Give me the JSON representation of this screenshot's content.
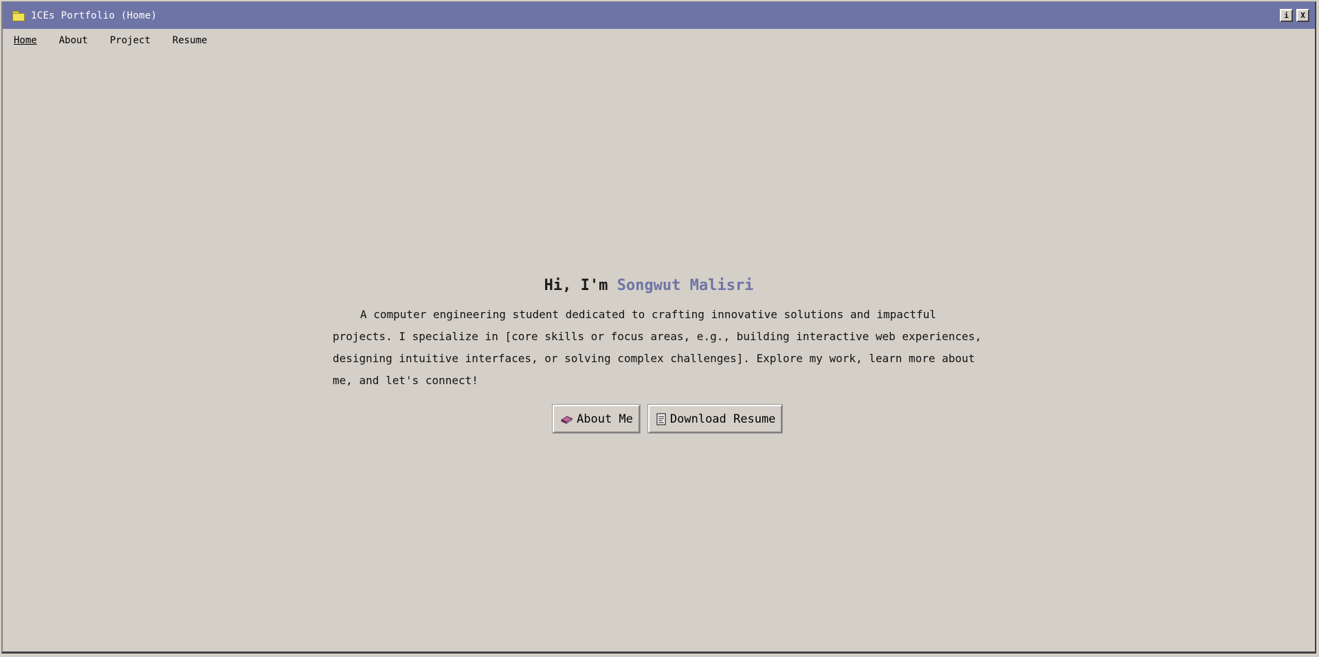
{
  "window": {
    "title": "1CEs Portfolio (Home)",
    "info_button": "i",
    "close_button": "X"
  },
  "menu": {
    "items": [
      {
        "label": "Home",
        "active": true
      },
      {
        "label": "About",
        "active": false
      },
      {
        "label": "Project",
        "active": false
      },
      {
        "label": "Resume",
        "active": false
      }
    ]
  },
  "hero": {
    "greeting": "Hi, I'm ",
    "name": "Songwut Malisri",
    "description": "A computer engineering student dedicated to crafting innovative solutions and impactful projects. I specialize in [core skills or focus areas, e.g., building interactive web experiences, designing intuitive interfaces, or solving complex challenges]. Explore my work, learn more about me, and let's connect!",
    "buttons": {
      "about": {
        "label": "About Me",
        "icon": "book-icon"
      },
      "resume": {
        "label": "Download Resume",
        "icon": "document-icon"
      }
    }
  },
  "colors": {
    "titlebar": "#6f74a6",
    "accent": "#6f74a6",
    "background": "#d4d0c8"
  }
}
